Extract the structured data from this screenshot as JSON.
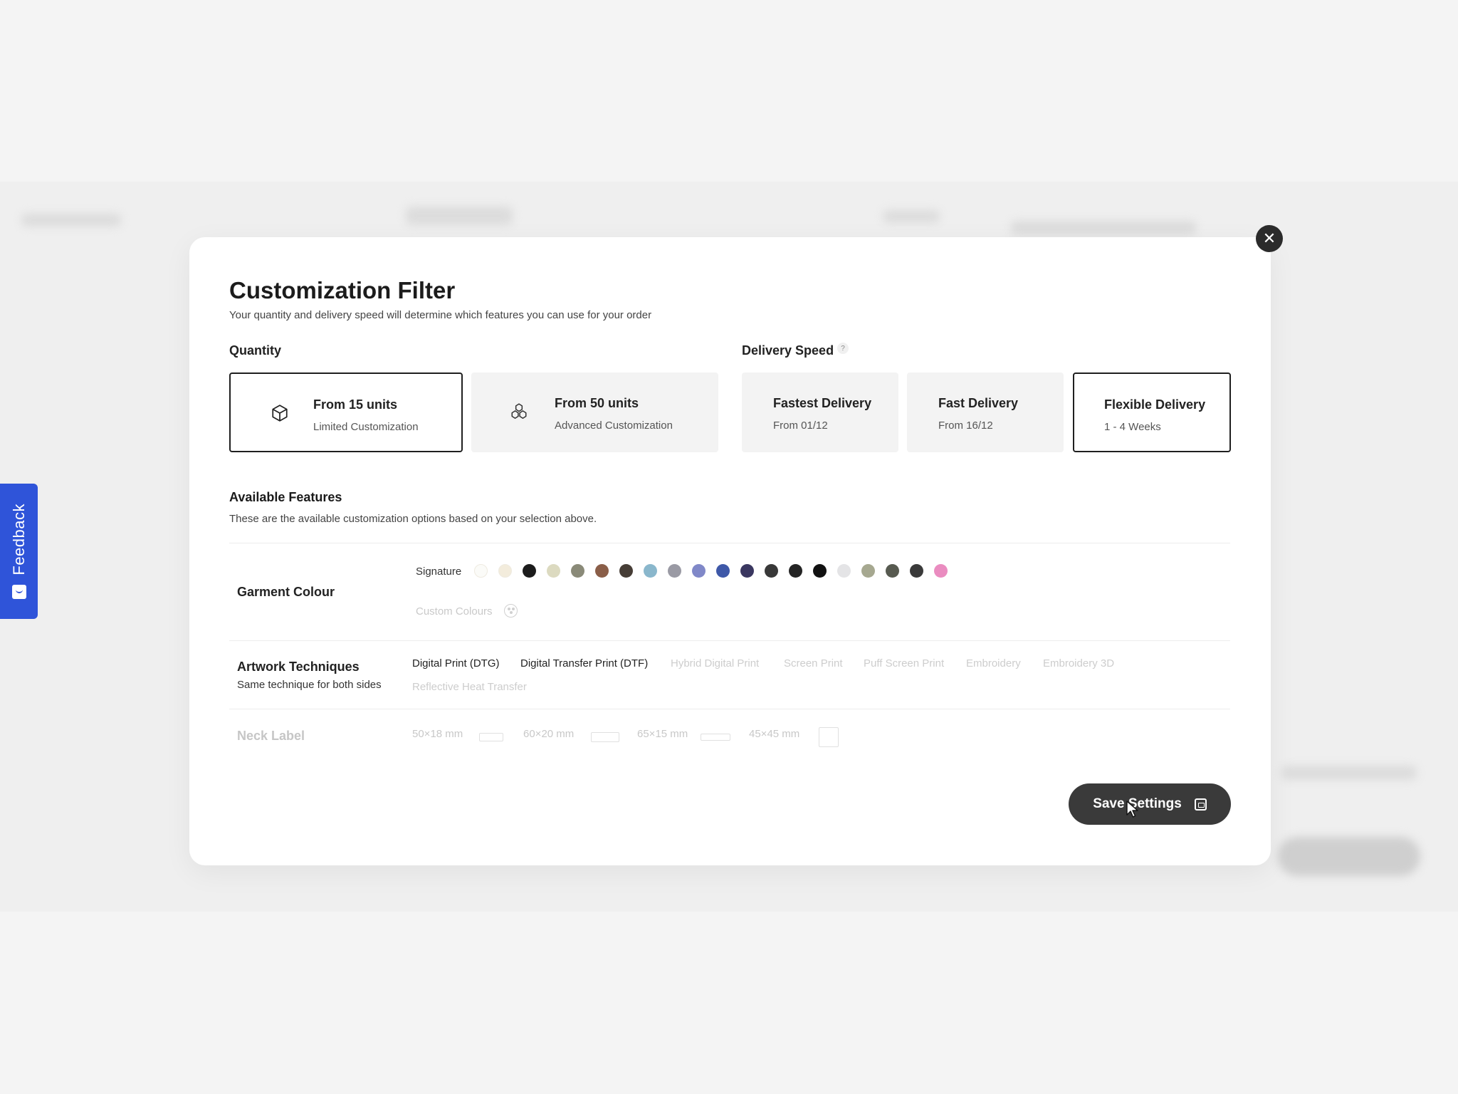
{
  "feedback": {
    "label": "Feedback"
  },
  "modal": {
    "title": "Customization Filter",
    "subtitle": "Your quantity and delivery speed will determine which features you can use for your order",
    "close_icon": "close-icon"
  },
  "quantity": {
    "label": "Quantity",
    "options": [
      {
        "name": "From 15 units",
        "sub": "Limited Customization",
        "icon": "cube-icon",
        "selected": true
      },
      {
        "name": "From 50 units",
        "sub": "Advanced Customization",
        "icon": "cubes-icon",
        "selected": false
      }
    ]
  },
  "delivery": {
    "label": "Delivery Speed",
    "help": "?",
    "options": [
      {
        "name": "Fastest Delivery",
        "sub": "From 01/12",
        "selected": false
      },
      {
        "name": "Fast Delivery",
        "sub": "From 16/12",
        "selected": false
      },
      {
        "name": "Flexible Delivery",
        "sub": "1 - 4 Weeks",
        "selected": true
      }
    ]
  },
  "features": {
    "title": "Available Features",
    "subtitle": "These are the available customization options based on your selection above.",
    "garment_colour": {
      "label": "Garment Colour",
      "signature_label": "Signature",
      "swatches": [
        "#fbfbf8",
        "#f3ecdc",
        "#1c1c1c",
        "#dcdac0",
        "#8a8a78",
        "#8a5e48",
        "#463d36",
        "#8ab7cc",
        "#9a9aa4",
        "#8088c8",
        "#3e58a8",
        "#3a3760",
        "#383838",
        "#242424",
        "#111111",
        "#e4e4e6",
        "#a6a890",
        "#575a50",
        "#3a3a3a",
        "#ea8cc0"
      ],
      "custom_label": "Custom Colours"
    },
    "artwork": {
      "label": "Artwork Techniques",
      "sub": "Same technique for both sides",
      "techniques": [
        {
          "name": "Digital Print (DTG)",
          "available": true
        },
        {
          "name": "Digital Transfer Print (DTF)",
          "available": true
        },
        {
          "name": "Hybrid Digital Print",
          "available": false
        },
        {
          "name": "Screen Print",
          "available": false
        },
        {
          "name": "Puff Screen Print",
          "available": false
        },
        {
          "name": "Embroidery",
          "available": false
        },
        {
          "name": "Embroidery 3D",
          "available": false
        },
        {
          "name": "Reflective Heat Transfer",
          "available": false
        }
      ]
    },
    "neck_label": {
      "label": "Neck Label",
      "sizes": [
        "50×18 mm",
        "60×20 mm",
        "65×15 mm",
        "45×45 mm"
      ]
    }
  },
  "save": {
    "label": "Save Settings",
    "icon": "save-icon"
  }
}
